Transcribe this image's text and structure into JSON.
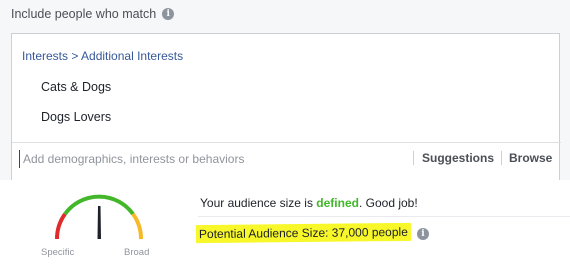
{
  "section": {
    "title": "Include people who match",
    "info_icon": "info-circle-icon"
  },
  "targeting": {
    "breadcrumb": "Interests > Additional Interests",
    "interests": [
      "Cats & Dogs",
      "Dogs Lovers"
    ],
    "search": {
      "placeholder": "Add demographics, interests or behaviors",
      "value": ""
    },
    "suggestions_label": "Suggestions",
    "browse_label": "Browse"
  },
  "audience": {
    "gauge": {
      "specific_label": "Specific",
      "broad_label": "Broad",
      "state": "defined",
      "colors": {
        "specific": "#e02b2b",
        "defined": "#42b72a",
        "broad": "#f7b928"
      }
    },
    "message_prefix": "Your audience size is ",
    "message_status": "defined",
    "message_suffix": ". Good job!",
    "potential_size": "Potential Audience Size: 37,000 people",
    "highlight_color": "#f7f72a"
  }
}
